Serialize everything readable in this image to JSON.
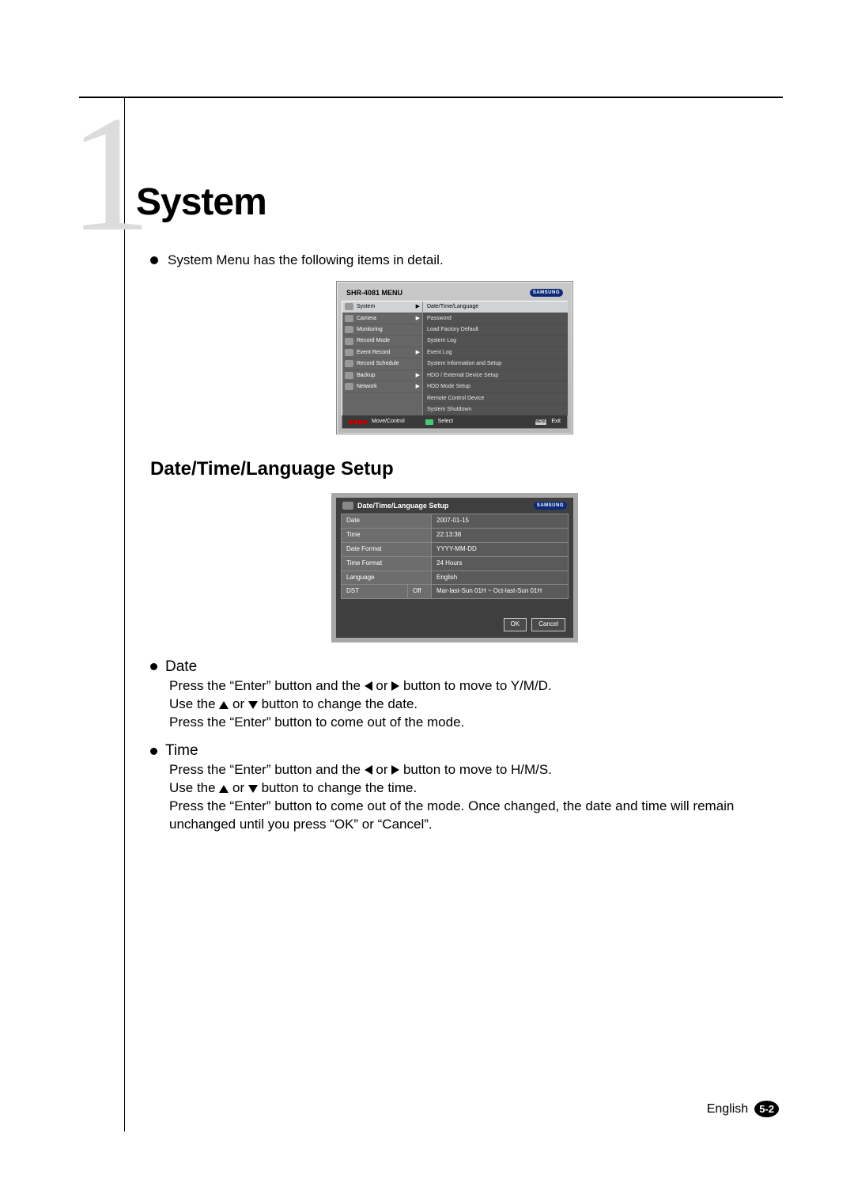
{
  "chapter_number": "1",
  "chapter_title": "System",
  "intro_bullet": "System Menu has the following items in detail.",
  "menu_ss": {
    "header": "SHR-4081 MENU",
    "brand": "SAMSUNG",
    "left_items": [
      {
        "label": "System",
        "arrow": true,
        "selected": true
      },
      {
        "label": "Camera",
        "arrow": true
      },
      {
        "label": "Monitoring"
      },
      {
        "label": "Record Mode"
      },
      {
        "label": "Event Record",
        "arrow": true
      },
      {
        "label": "Record Schedule"
      },
      {
        "label": "Backup",
        "arrow": true
      },
      {
        "label": "Network",
        "arrow": true
      }
    ],
    "right_items": [
      {
        "label": "Date/Time/Language",
        "selected": true
      },
      {
        "label": "Password"
      },
      {
        "label": "Load Factory Default"
      },
      {
        "label": "System Log"
      },
      {
        "label": "Event Log"
      },
      {
        "label": "System Information and Setup"
      },
      {
        "label": "HDD / External Device Setup"
      },
      {
        "label": "HDD Mode Setup"
      },
      {
        "label": "Remote Control Device"
      },
      {
        "label": "System Shutdown"
      }
    ],
    "footer": {
      "move": "Move/Control",
      "select": "Select",
      "exit": "Exit",
      "menu_label": "MENU"
    }
  },
  "section_heading": "Date/Time/Language Setup",
  "setup_ss": {
    "header": "Date/Time/Language Setup",
    "brand": "SAMSUNG",
    "rows": {
      "date_label": "Date",
      "date_value": "2007-01-15",
      "time_label": "Time",
      "time_value": "22:13:38",
      "dfmt_label": "Date Format",
      "dfmt_value": "YYYY-MM-DD",
      "tfmt_label": "Time Format",
      "tfmt_value": "24 Hours",
      "lang_label": "Language",
      "lang_value": "English",
      "dst_label": "DST",
      "dst_sub": "Off",
      "dst_value": "Mar-last-Sun 01H ~ Oct-last-Sun 01H"
    },
    "ok": "OK",
    "cancel": "Cancel"
  },
  "date_section": {
    "title": "Date",
    "l1a": "Press the “Enter” button and the ",
    "l1b": " or ",
    "l1c": " button to move to Y/M/D.",
    "l2a": "Use the  ",
    "l2b": " or ",
    "l2c": " button to change the date.",
    "l3": "Press the “Enter” button to come out of the mode."
  },
  "time_section": {
    "title": "Time",
    "l1a": "Press the “Enter” button and the ",
    "l1b": " or ",
    "l1c": " button to move to H/M/S.",
    "l2a": "Use the  ",
    "l2b": " or ",
    "l2c": " button to change the time.",
    "l3": "Press the “Enter” button to come out of the mode. Once changed, the date and time will remain unchanged until you press “OK” or “Cancel”."
  },
  "footer": {
    "lang": "English",
    "page": "5-2"
  }
}
